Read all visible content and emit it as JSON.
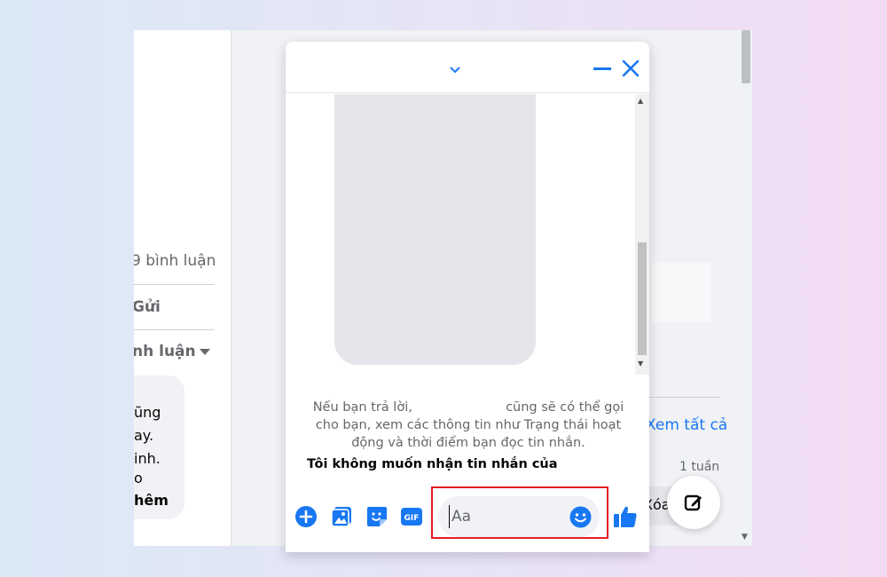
{
  "feed": {
    "comments_count": "9 bình luận",
    "send_label": "Gửi",
    "sort_label": "nh luận",
    "comment_lines": [
      "ũng",
      "ay.",
      "inh.",
      "o",
      "hêm"
    ]
  },
  "sidebar": {
    "see_all": "Xem tất cả",
    "time_ago": "1 tuần",
    "delete_label": "Xóa"
  },
  "chat": {
    "notice_part1": "Nếu bạn trả lời,",
    "notice_part2": "cũng sẽ có thể gọi cho bạn, xem các thông tin như Trạng thái hoạt động và thời điểm bạn đọc tin nhắn.",
    "decline_text": "Tôi không muốn nhận tin nhắn của",
    "input_placeholder": "Aa",
    "gif_label": "GIF"
  },
  "colors": {
    "accent": "#1877f2",
    "highlight": "#e41e26"
  },
  "icons": {
    "header": [
      "chevron-down-icon",
      "minimize-icon",
      "close-icon"
    ],
    "composer": [
      "plus-circle-icon",
      "image-icon",
      "sticker-icon",
      "gif-icon",
      "emoji-icon",
      "thumbs-up-icon"
    ],
    "fab": "compose-icon"
  }
}
